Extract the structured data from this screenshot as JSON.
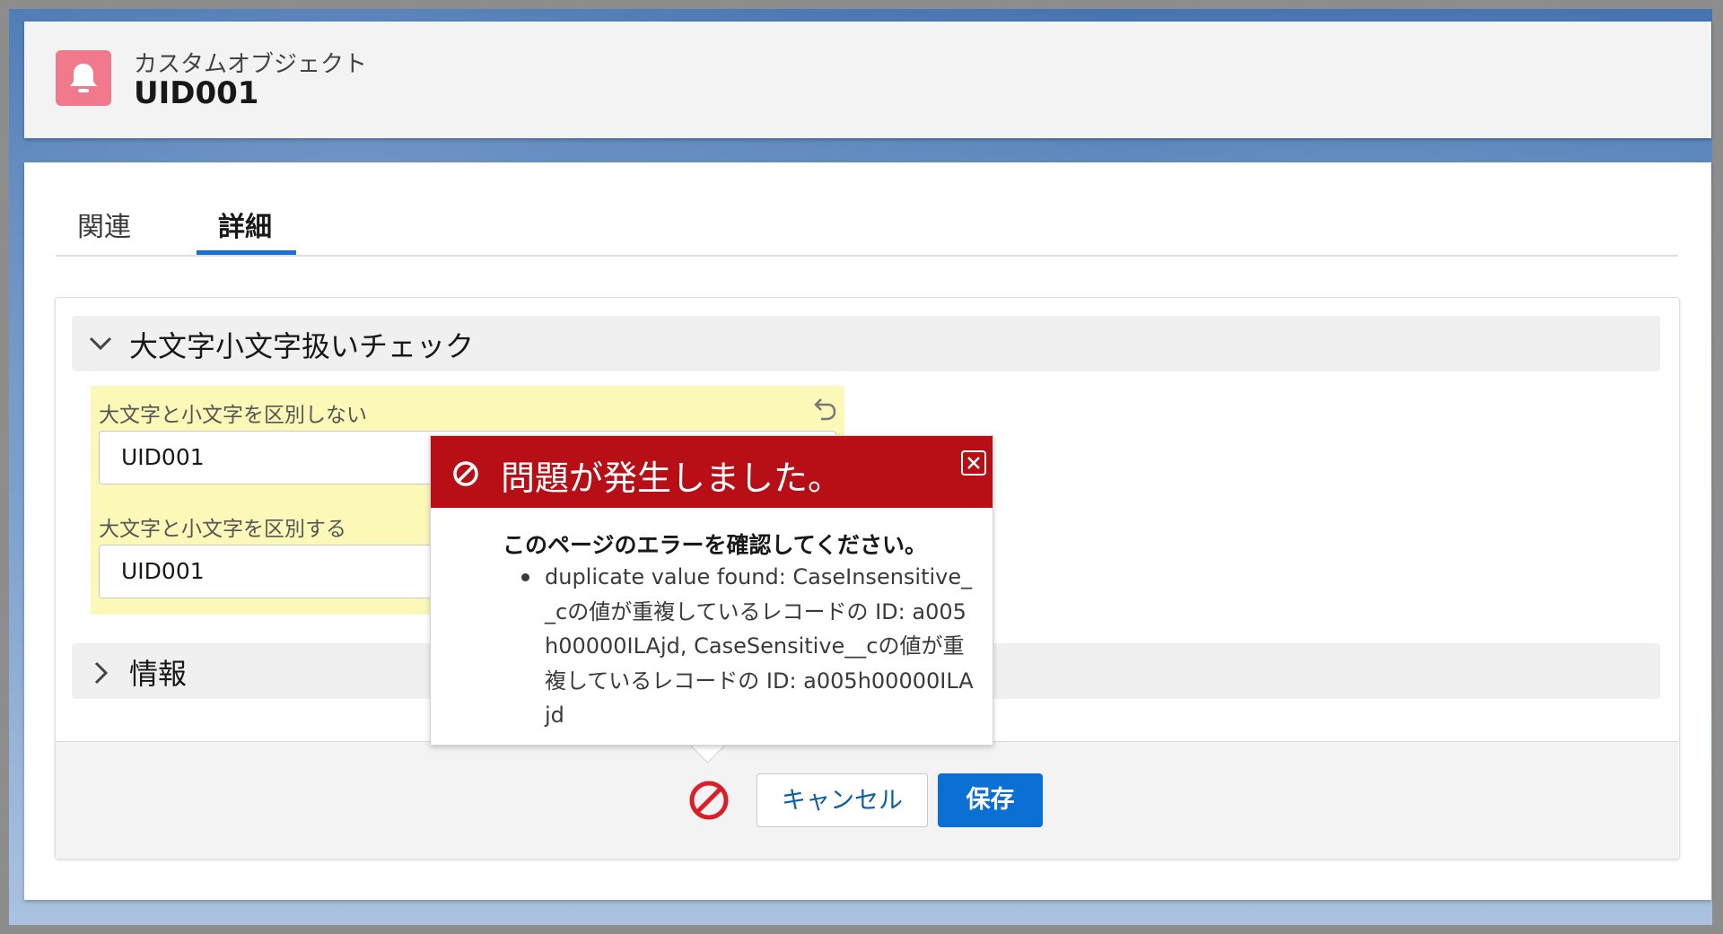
{
  "header": {
    "object_type": "カスタムオブジェクト",
    "record_name": "UID001",
    "icon": "bell-icon"
  },
  "tabs": [
    {
      "label": "関連",
      "active": false
    },
    {
      "label": "詳細",
      "active": true
    }
  ],
  "sections": [
    {
      "title": "大文字小文字扱いチェック",
      "expanded": true,
      "fields": [
        {
          "label": "大文字と小文字を区別しない",
          "value": "UID001"
        },
        {
          "label": "大文字と小文字を区別する",
          "value": "UID001"
        }
      ]
    },
    {
      "title": "情報",
      "expanded": false
    }
  ],
  "footer": {
    "cancel_label": "キャンセル",
    "save_label": "保存"
  },
  "error_popover": {
    "title": "問題が発生しました。",
    "heading": "このページのエラーを確認してください。",
    "message": "duplicate value found: CaseInsensitive__cの値が重複しているレコードの ID: a005h00000ILAjd, CaseSensitive__cの値が重複しているレコードの ID: a005h00000ILAjd"
  },
  "colors": {
    "accent": "#0b6fd4",
    "error": "#b80f17",
    "highlight": "#fbf8b8",
    "icon_bg": "#f0798b"
  }
}
